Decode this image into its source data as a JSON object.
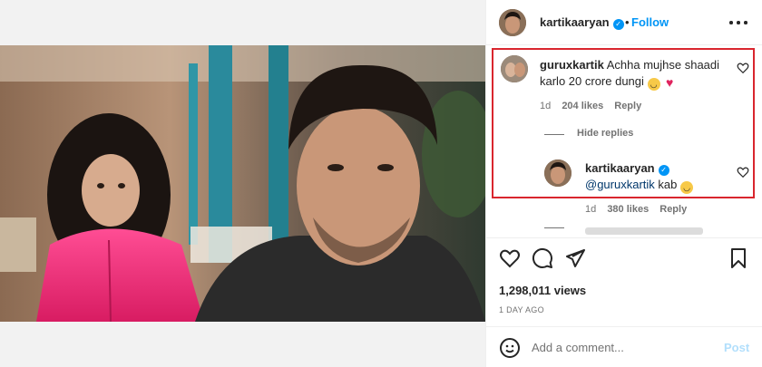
{
  "header": {
    "username": "kartikaaryan",
    "separator": "•",
    "follow_label": "Follow"
  },
  "comments": [
    {
      "username": "guruxkartik",
      "text": "Achha mujhse shaadi karlo 20 crore dungi",
      "time": "1d",
      "likes": "204 likes",
      "reply_label": "Reply",
      "hide_replies_label": "Hide replies"
    }
  ],
  "reply": {
    "username": "kartikaaryan",
    "mention": "@guruxkartik",
    "text": "kab",
    "time": "1d",
    "likes": "380 likes",
    "reply_label": "Reply"
  },
  "actions": {
    "views": "1,298,011 views",
    "time_ago": "1 DAY AGO"
  },
  "add_comment": {
    "placeholder": "Add a comment...",
    "post_label": "Post"
  },
  "colors": {
    "accent": "#0095f6",
    "highlight_border": "#d9262e",
    "jacket_pink": "#e8337a"
  },
  "icons": [
    "heart-icon",
    "comment-icon",
    "share-icon",
    "bookmark-icon",
    "emoji-icon",
    "more-icon",
    "verified-icon"
  ]
}
